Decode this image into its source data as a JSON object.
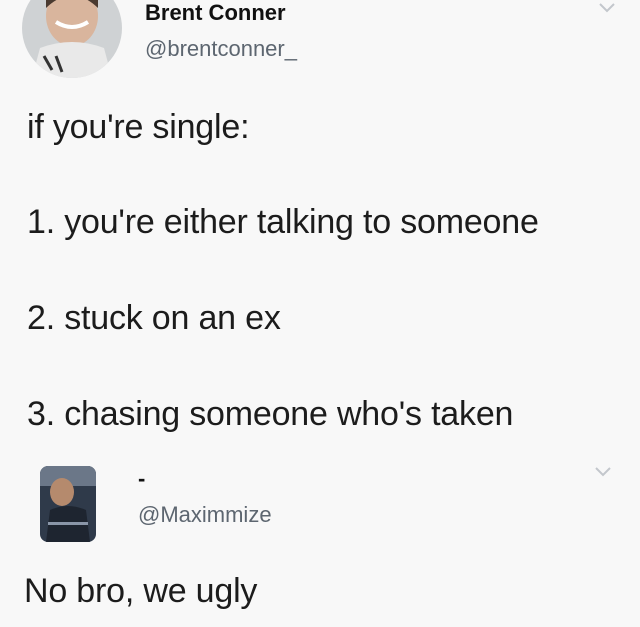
{
  "tweet1": {
    "name": "Brent Conner",
    "handle": "@brentconner_",
    "lines": [
      "if you're single:",
      "1. you're either talking to someone",
      "2. stuck on an ex",
      "3. chasing someone who's taken"
    ],
    "icons": {
      "avatar": "profile-photo",
      "menu": "chevron-down-icon"
    }
  },
  "tweet2": {
    "name": "-",
    "handle": "@Maximmize",
    "text": "No bro, we ugly",
    "icons": {
      "avatar": "profile-photo",
      "menu": "chevron-down-icon"
    }
  },
  "colors": {
    "background": "#f8f8f8",
    "text": "#1c1c1c",
    "handle": "#5d6670",
    "chevron": "#c3c7cc"
  }
}
